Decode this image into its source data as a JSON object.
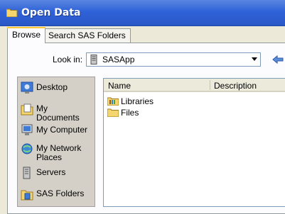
{
  "window": {
    "title": "Open Data"
  },
  "tabs": [
    {
      "label": "Browse",
      "active": true
    },
    {
      "label": "Search SAS Folders",
      "active": false
    }
  ],
  "look_in": {
    "label": "Look in:",
    "value": "SASApp"
  },
  "places": [
    {
      "label": "Desktop",
      "icon": "desktop-icon"
    },
    {
      "label": "My Documents",
      "icon": "my-documents-icon"
    },
    {
      "label": "My Computer",
      "icon": "my-computer-icon"
    },
    {
      "label": "My Network Places",
      "icon": "network-places-icon"
    },
    {
      "label": "Servers",
      "icon": "server-icon"
    },
    {
      "label": "SAS Folders",
      "icon": "sas-folders-icon"
    }
  ],
  "file_list": {
    "columns": [
      "Name",
      "Description"
    ],
    "items": [
      {
        "name": "Libraries",
        "icon": "library-icon"
      },
      {
        "name": "Files",
        "icon": "folder-icon"
      }
    ]
  }
}
